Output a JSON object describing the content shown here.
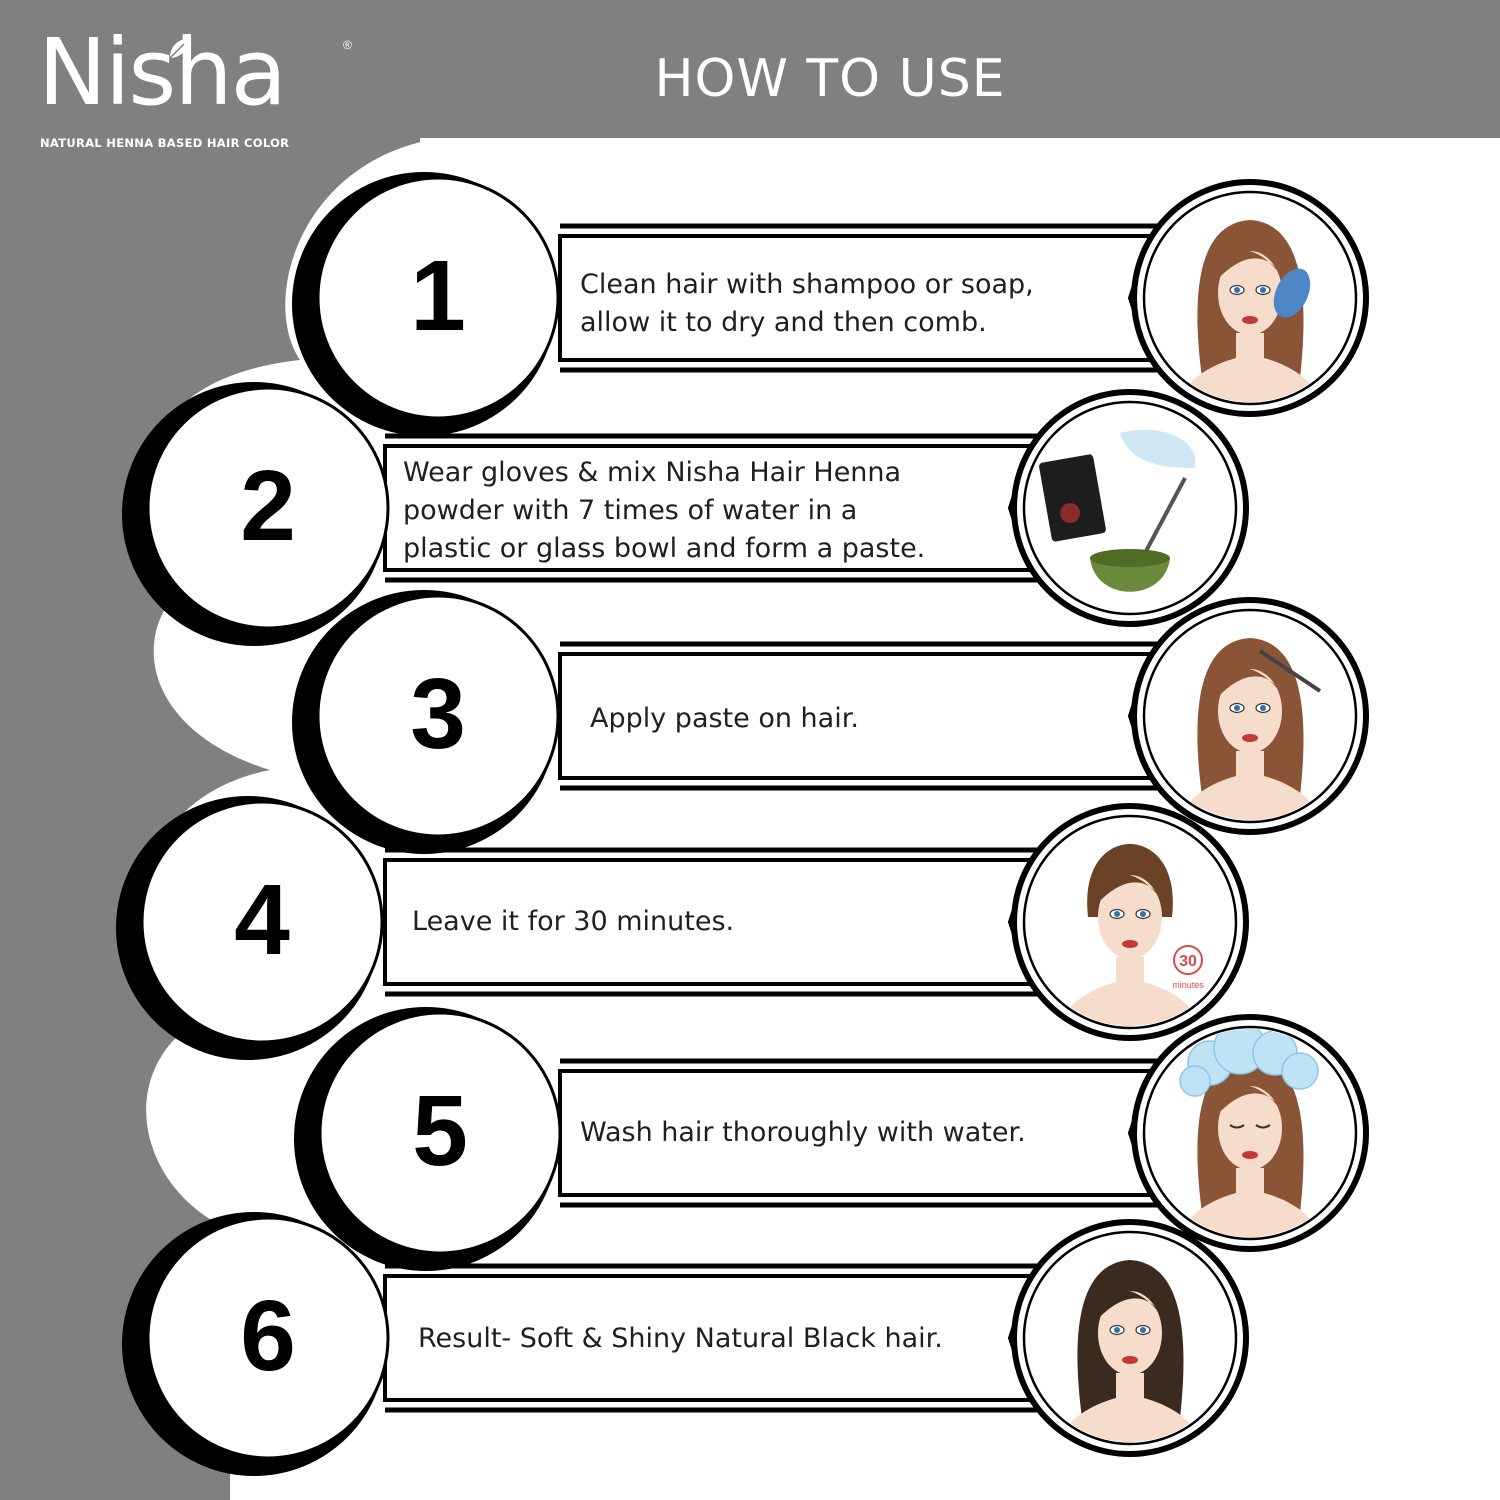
{
  "brand": {
    "name": "Nisha",
    "registered_mark": "®",
    "tagline": "NATURAL HENNA BASED HAIR COLOR"
  },
  "heading": "HOW TO USE",
  "colors": {
    "banner_gray": "#808080",
    "panel_white": "#ffffff",
    "outline_black": "#000000",
    "hair_brown": "#7a4a2e",
    "skin": "#f6dccb"
  },
  "steps": [
    {
      "number": "1",
      "lines": [
        "Clean hair with shampoo or soap,",
        "allow it to dry and then comb."
      ],
      "icon": "woman-combing-hair-icon"
    },
    {
      "number": "2",
      "lines": [
        "Wear gloves & mix Nisha Hair Henna",
        "powder with 7 times of water in a",
        "plastic or glass bowl and form a paste."
      ],
      "icon": "henna-mixing-bowl-icon"
    },
    {
      "number": "3",
      "lines": [
        "Apply paste on hair."
      ],
      "icon": "woman-applying-paste-icon"
    },
    {
      "number": "4",
      "lines": [
        "Leave it for 30 minutes."
      ],
      "icon": "woman-timer-icon",
      "timer_value": "30",
      "timer_unit": "minutes"
    },
    {
      "number": "5",
      "lines": [
        "Wash hair thoroughly with water."
      ],
      "icon": "woman-washing-hair-icon"
    },
    {
      "number": "6",
      "lines": [
        "Result- Soft & Shiny Natural Black hair."
      ],
      "icon": "woman-shiny-black-hair-icon"
    }
  ]
}
